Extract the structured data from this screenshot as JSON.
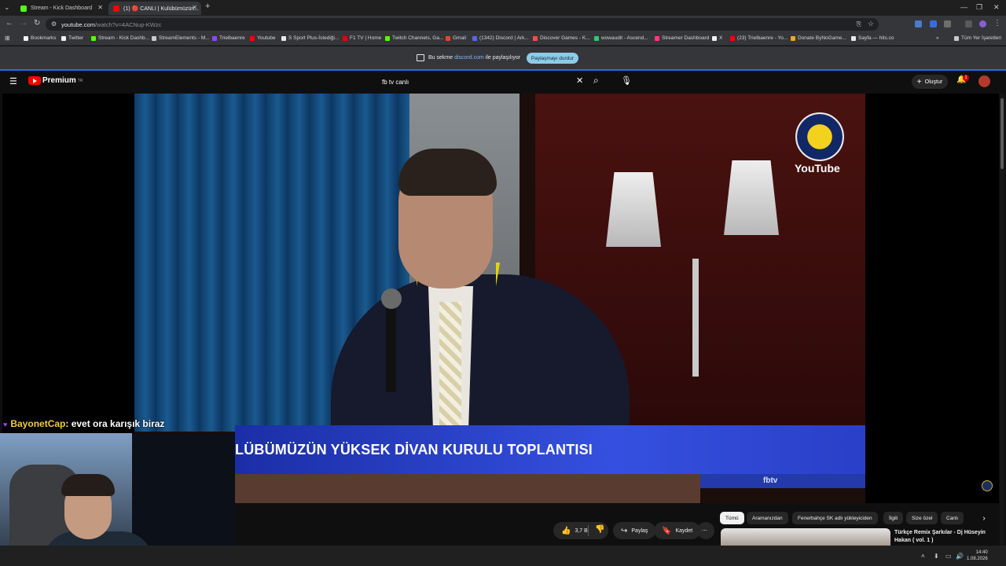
{
  "browser": {
    "tabs": [
      {
        "label": "Stream - Kick Dashboard",
        "favicon_color": "#53fc18"
      },
      {
        "label": "(1) 🔴 CANLI | Kulübümüzün...",
        "favicon_color": "#ff0000"
      }
    ],
    "new_tab": "+",
    "url_host": "youtube.com",
    "url_path": "/watch?v=4ACNup-KWzc",
    "bookmarks": [
      {
        "label": "Bookmarks",
        "color": "#f1f1f1"
      },
      {
        "label": "Twitter",
        "color": "#f1f1f1"
      },
      {
        "label": "Stream - Kick Dashb...",
        "color": "#53fc18"
      },
      {
        "label": "StreamElements - M...",
        "color": "#c9c9c9"
      },
      {
        "label": "Trielbaenre",
        "color": "#9146ff"
      },
      {
        "label": "Youtube",
        "color": "#ff0000"
      },
      {
        "label": "S Sport Plus-İstediği...",
        "color": "#e8e8e8"
      },
      {
        "label": "F1 TV | Home",
        "color": "#e10600"
      },
      {
        "label": "Twitch Channels, Ga...",
        "color": "#53fc18"
      },
      {
        "label": "Gmail",
        "color": "#ea4335"
      },
      {
        "label": "(1342) Discord | Ark...",
        "color": "#5865f2"
      },
      {
        "label": "Discover Games - K...",
        "color": "#ff4b4b"
      },
      {
        "label": "wowaudit - Ascend...",
        "color": "#2ecc71"
      },
      {
        "label": "Streamer Dashboard",
        "color": "#ff3b7a"
      },
      {
        "label": "X",
        "color": "#f1f1f1"
      },
      {
        "label": "(23) Trielbaenre - Yo...",
        "color": "#ff0000"
      },
      {
        "label": "Donate ByNoGame...",
        "color": "#f5a623"
      },
      {
        "label": "Sayfa — hits.co",
        "color": "#e8e8e8"
      }
    ],
    "all_bookmarks": "Tüm Yer İşaretleri",
    "share_prefix": "Bu sekme",
    "share_site": "discord.com",
    "share_suffix": "ile paylaşılıyor",
    "share_stop": "Paylaşmayı durdur"
  },
  "youtube": {
    "logo": "Premium",
    "logo_region": "TR",
    "search_query": "fb tv canlı",
    "create_label": "Oluştur",
    "notification_count": "1",
    "video": {
      "banner_text": "LÜBÜMÜZÜN YÜKSEK DİVAN KURULU TOPLANTISI",
      "watermark": "YouTube",
      "corner_text": "fbtv"
    },
    "like_count": "3,7 B",
    "share_label": "Paylaş",
    "save_label": "Kaydet",
    "chips": [
      "Tümü",
      "Aramanızdan",
      "Fenerbahçe SK adlı yükleyiciden",
      "İlgili",
      "Size özel",
      "Canlı"
    ],
    "recommendation": {
      "title": "Türkçe Remix Şarkılar - Dj Hüseyin Hakan ( vol. 1 )"
    }
  },
  "chat": {
    "user": "BayonetCap",
    "message": ": evet ora karışık biraz"
  },
  "taskbar": {
    "time": "14:40",
    "date": "1.08.2026"
  },
  "colors": {
    "accent": "#1a73e8",
    "yt_red": "#ff0000",
    "share_pill": "#8ecbe8",
    "banner_blue": "#2a3fc7"
  }
}
